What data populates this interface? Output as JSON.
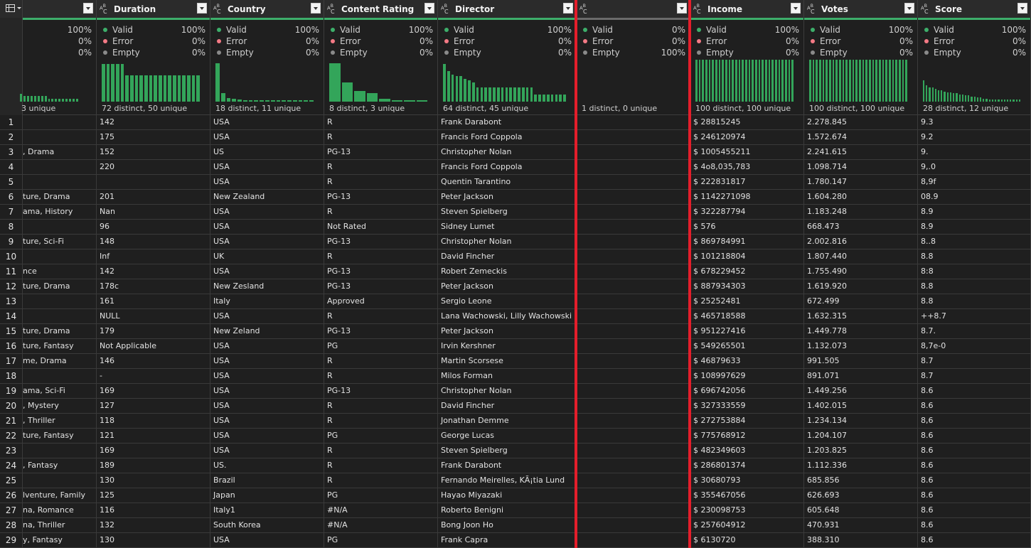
{
  "table_menu_icon": "table-icon",
  "quality_labels": {
    "valid": "Valid",
    "error": "Error",
    "empty": "Empty"
  },
  "colors": {
    "valid": "#3dae6a",
    "error": "#f47a85",
    "empty": "#8a8a8a",
    "bar": "#33a55a",
    "highlight": "#e41e2b"
  },
  "columns": [
    {
      "id": "genre",
      "name": "",
      "valid": "100%",
      "error": "0%",
      "empty": "0%",
      "distinct": "3 unique",
      "bars": [
        0.18,
        0.13,
        0.13,
        0.13,
        0.13,
        0.13,
        0.13,
        0.13,
        0.07,
        0.07,
        0.07,
        0.07,
        0.07,
        0.07,
        0.07,
        0.07,
        0.07
      ]
    },
    {
      "id": "duration",
      "name": "Duration",
      "valid": "100%",
      "error": "0%",
      "empty": "0%",
      "distinct": "72 distinct, 50 unique",
      "bars": [
        0.88,
        0.88,
        0.88,
        0.88,
        0.88,
        0.62,
        0.62,
        0.62,
        0.62,
        0.62,
        0.62,
        0.62,
        0.62,
        0.62,
        0.62,
        0.62,
        0.62,
        0.62,
        0.62,
        0.62,
        0.62
      ]
    },
    {
      "id": "country",
      "name": "Country",
      "valid": "100%",
      "error": "0%",
      "empty": "0%",
      "distinct": "18 distinct, 11 unique",
      "bars": [
        0.9,
        0.2,
        0.08,
        0.06,
        0.05,
        0.04,
        0.04,
        0.03,
        0.03,
        0.03,
        0.03,
        0.03,
        0.03,
        0.03,
        0.03,
        0.03,
        0.03,
        0.03
      ]
    },
    {
      "id": "content_rating",
      "name": "Content Rating",
      "valid": "100%",
      "error": "0%",
      "empty": "0%",
      "distinct": "8 distinct, 3 unique",
      "bars": [
        0.9,
        0.45,
        0.25,
        0.2,
        0.07,
        0.04,
        0.03,
        0.03
      ]
    },
    {
      "id": "director",
      "name": "Director",
      "valid": "100%",
      "error": "0%",
      "empty": "0%",
      "distinct": "64 distinct, 45 unique",
      "bars": [
        0.88,
        0.72,
        0.64,
        0.6,
        0.6,
        0.53,
        0.5,
        0.45,
        0.33,
        0.33,
        0.33,
        0.33,
        0.33,
        0.33,
        0.33,
        0.33,
        0.33,
        0.33,
        0.33,
        0.33,
        0.33,
        0.33,
        0.17,
        0.17,
        0.17,
        0.17,
        0.17,
        0.17,
        0.17,
        0.17
      ]
    },
    {
      "id": "blank",
      "name": "",
      "valid": "0%",
      "error": "0%",
      "empty": "100%",
      "distinct": "1 distinct, 0 unique",
      "bars": []
    },
    {
      "id": "income",
      "name": "Income",
      "valid": "100%",
      "error": "0%",
      "empty": "0%",
      "distinct": "100 distinct, 100 unique",
      "bars": [
        0.98,
        0.98,
        0.98,
        0.98,
        0.98,
        0.98,
        0.98,
        0.98,
        0.98,
        0.98,
        0.98,
        0.98,
        0.98,
        0.98,
        0.98,
        0.98,
        0.98,
        0.98,
        0.98,
        0.98,
        0.98,
        0.98,
        0.98,
        0.98,
        0.98,
        0.98,
        0.98,
        0.98,
        0.98,
        0.98
      ]
    },
    {
      "id": "votes",
      "name": "Votes",
      "valid": "100%",
      "error": "0%",
      "empty": "0%",
      "distinct": "100 distinct, 100 unique",
      "bars": [
        0.98,
        0.98,
        0.98,
        0.98,
        0.98,
        0.98,
        0.98,
        0.98,
        0.98,
        0.98,
        0.98,
        0.98,
        0.98,
        0.98,
        0.98,
        0.98,
        0.98,
        0.98,
        0.98,
        0.98,
        0.98,
        0.98,
        0.98,
        0.98,
        0.98,
        0.98,
        0.98,
        0.98,
        0.98,
        0.98
      ]
    },
    {
      "id": "score",
      "name": "Score",
      "valid": "100%",
      "error": "0%",
      "empty": "0%",
      "distinct": "28 distinct, 12 unique",
      "bars": [
        0.5,
        0.38,
        0.33,
        0.33,
        0.3,
        0.27,
        0.27,
        0.24,
        0.22,
        0.22,
        0.2,
        0.2,
        0.17,
        0.17,
        0.15,
        0.15,
        0.12,
        0.12,
        0.1,
        0.1,
        0.07,
        0.07,
        0.05,
        0.05,
        0.05,
        0.05,
        0.05,
        0.05,
        0.05,
        0.05,
        0.05,
        0.05,
        0.05
      ]
    }
  ],
  "rows": [
    [
      "1",
      "",
      "142",
      "USA",
      "R",
      "Frank Darabont",
      "",
      "$ 28815245",
      "2.278.845",
      "9.3"
    ],
    [
      "2",
      "",
      "175",
      "USA",
      "R",
      "Francis Ford Coppola",
      "",
      "$ 246120974",
      "1.572.674",
      "9.2"
    ],
    [
      "3",
      ", Drama",
      "152",
      "US",
      "PG-13",
      "Christopher Nolan",
      "",
      "$ 1005455211",
      "2.241.615",
      "9."
    ],
    [
      "4",
      "",
      "220",
      "USA",
      "R",
      "Francis Ford Coppola",
      "",
      "$ 4o8,035,783",
      "1.098.714",
      "9,.0"
    ],
    [
      "5",
      "",
      "",
      "USA",
      "R",
      "Quentin Tarantino",
      "",
      "$ 222831817",
      "1.780.147",
      "8,9f"
    ],
    [
      "6",
      "ture, Drama",
      "201",
      "New Zealand",
      "PG-13",
      "Peter Jackson",
      "",
      "$ 1142271098",
      "1.604.280",
      "08.9"
    ],
    [
      "7",
      "ama, History",
      "Nan",
      "USA",
      "R",
      "Steven Spielberg",
      "",
      "$ 322287794",
      "1.183.248",
      "8.9"
    ],
    [
      "8",
      "",
      "96",
      "USA",
      "Not Rated",
      "Sidney Lumet",
      "",
      "$ 576",
      "668.473",
      "8.9"
    ],
    [
      "9",
      "ture, Sci-Fi",
      "148",
      "USA",
      "PG-13",
      "Christopher Nolan",
      "",
      "$ 869784991",
      "2.002.816",
      "8..8"
    ],
    [
      "10",
      "",
      "Inf",
      "UK",
      "R",
      "David Fincher",
      "",
      "$ 101218804",
      "1.807.440",
      "8.8"
    ],
    [
      "11",
      "nce",
      "142",
      "USA",
      "PG-13",
      "Robert Zemeckis",
      "",
      "$ 678229452",
      "1.755.490",
      "8:8"
    ],
    [
      "12",
      "ture, Drama",
      "178c",
      "New Zesland",
      "PG-13",
      "Peter Jackson",
      "",
      "$ 887934303",
      "1.619.920",
      "8.8"
    ],
    [
      "13",
      "",
      "161",
      "Italy",
      "Approved",
      "Sergio Leone",
      "",
      "$ 25252481",
      "672.499",
      "8.8"
    ],
    [
      "14",
      "",
      "NULL",
      "USA",
      "R",
      "Lana Wachowski, Lilly Wachowski",
      "",
      "$ 465718588",
      "1.632.315",
      "++8.7"
    ],
    [
      "15",
      "ture, Drama",
      "179",
      "New Zeland",
      "PG-13",
      "Peter Jackson",
      "",
      "$ 951227416",
      "1.449.778",
      "8.7."
    ],
    [
      "16",
      "ture, Fantasy",
      "Not Applicable",
      "USA",
      "PG",
      "Irvin Kershner",
      "",
      "$ 549265501",
      "1.132.073",
      "8,7e-0"
    ],
    [
      "17",
      "me, Drama",
      "146",
      "USA",
      "R",
      "Martin Scorsese",
      "",
      "$ 46879633",
      "991.505",
      "8.7"
    ],
    [
      "18",
      "",
      "-",
      "USA",
      "R",
      "Milos Forman",
      "",
      "$ 108997629",
      "891.071",
      "8.7"
    ],
    [
      "19",
      "ama, Sci-Fi",
      "169",
      "USA",
      "PG-13",
      "Christopher Nolan",
      "",
      "$ 696742056",
      "1.449.256",
      "8.6"
    ],
    [
      "20",
      ", Mystery",
      "127",
      "USA",
      "R",
      "David Fincher",
      "",
      "$ 327333559",
      "1.402.015",
      "8.6"
    ],
    [
      "21",
      ", Thriller",
      "118",
      "USA",
      "R",
      "Jonathan Demme",
      "",
      "$ 272753884",
      "1.234.134",
      "8,6"
    ],
    [
      "22",
      "ture, Fantasy",
      "121",
      "USA",
      "PG",
      "George Lucas",
      "",
      "$ 775768912",
      "1.204.107",
      "8.6"
    ],
    [
      "23",
      "",
      "169",
      "USA",
      "R",
      "Steven Spielberg",
      "",
      "$ 482349603",
      "1.203.825",
      "8.6"
    ],
    [
      "24",
      ", Fantasy",
      "189",
      "US.",
      "R",
      "Frank Darabont",
      "",
      "$ 286801374",
      "1.112.336",
      "8.6"
    ],
    [
      "25",
      "",
      "130",
      "Brazil",
      "R",
      "Fernando Meirelles, KÃ¡tia Lund",
      "",
      "$ 30680793",
      "685.856",
      "8.6"
    ],
    [
      "26",
      "lventure, Family",
      "125",
      "Japan",
      "PG",
      "Hayao Miyazaki",
      "",
      "$ 355467056",
      "626.693",
      "8.6"
    ],
    [
      "27",
      "na, Romance",
      "116",
      "Italy1",
      "#N/A",
      "Roberto Benigni",
      "",
      "$ 230098753",
      "605.648",
      "8.6"
    ],
    [
      "28",
      "na, Thriller",
      "132",
      "South Korea",
      "#N/A",
      "Bong Joon Ho",
      "",
      "$ 257604912",
      "470.931",
      "8.6"
    ],
    [
      "29",
      "y, Fantasy",
      "130",
      "USA",
      "PG",
      "Frank Capra",
      "",
      "$ 6130720",
      "388.310",
      "8.6"
    ]
  ]
}
